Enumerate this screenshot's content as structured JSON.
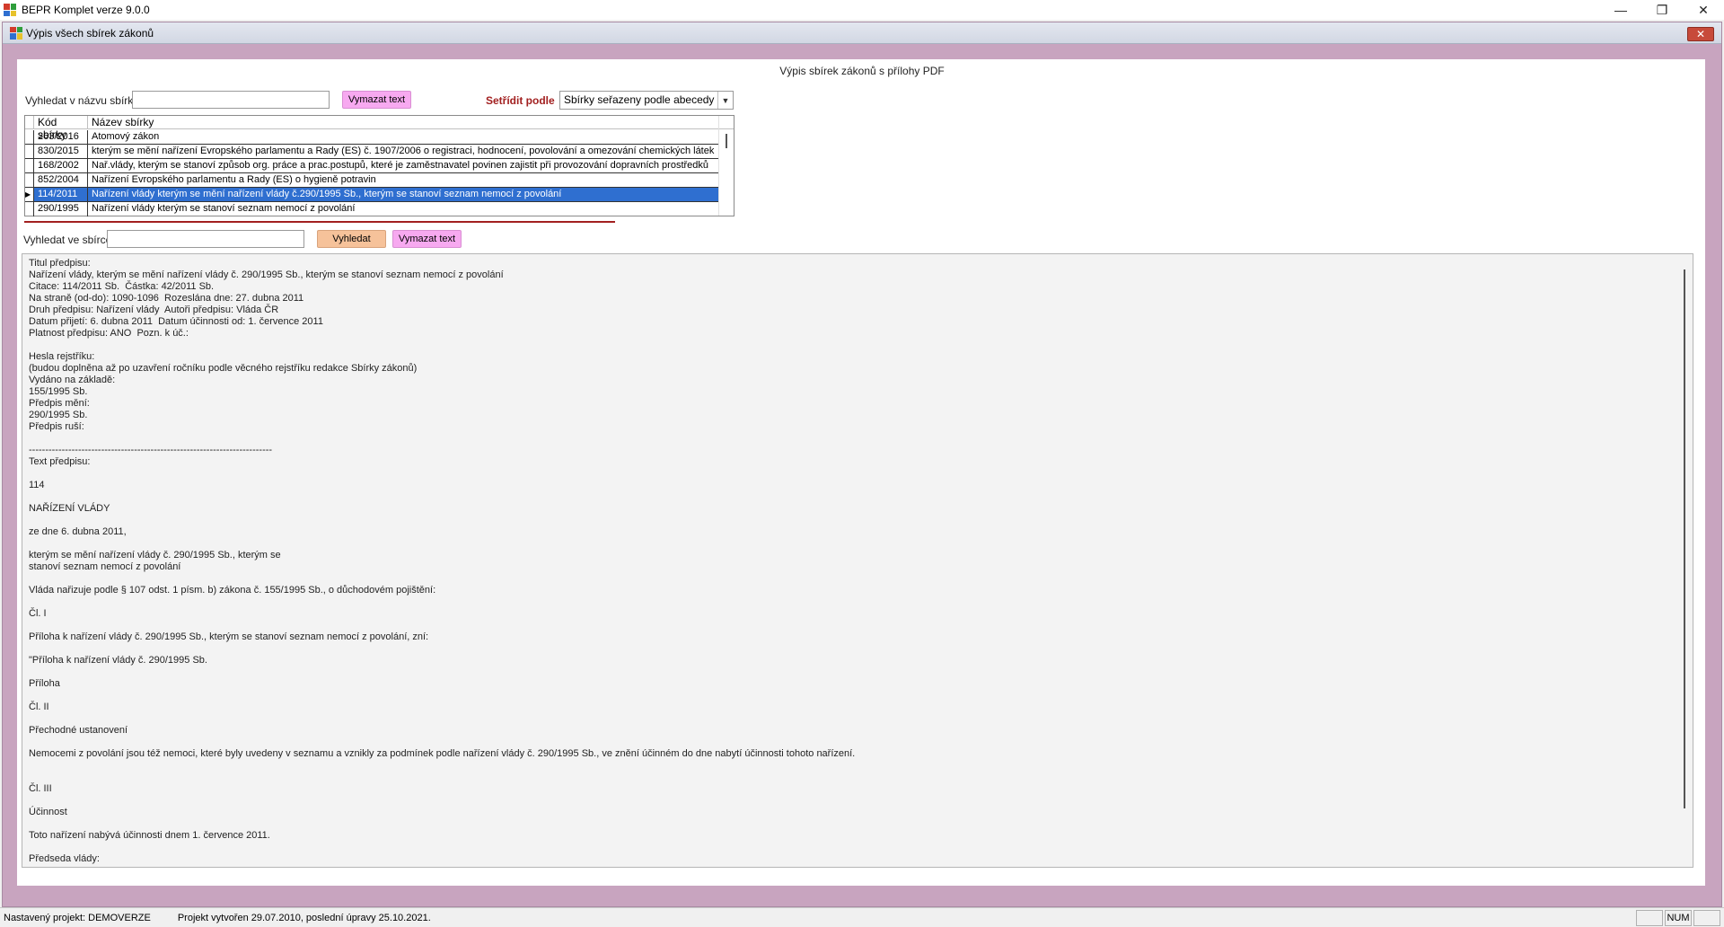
{
  "app": {
    "title": "BEPR Komplet verze 9.0.0"
  },
  "window_controls": {
    "minimize": "—",
    "maximize": "❐",
    "close": "✕"
  },
  "child_window": {
    "title": "Výpis všech sbírek zákonů",
    "close": "✕"
  },
  "panel": {
    "heading": "Výpis sbírek zákonů s přílohy PDF"
  },
  "search_name": {
    "label": "Vyhledat v názvu sbírky",
    "value": "",
    "clear_button": "Vymazat text"
  },
  "sort": {
    "label": "Setřídit podle",
    "selected": "Sbírky seřazeny podle abecedy"
  },
  "grid": {
    "headers": [
      "Kód sbírky",
      "Název sbírky"
    ],
    "rows": [
      {
        "code": "263/2016",
        "name": "Atomový zákon"
      },
      {
        "code": "830/2015",
        "name": "kterým se mění nařízení Evropského parlamentu a Rady (ES) č. 1907/2006 o registraci, hodnocení, povolování a omezování chemických látek"
      },
      {
        "code": "168/2002",
        "name": "Nař.vlády, kterým se stanoví způsob org. práce a prac.postupů, které je zaměstnavatel povinen zajistit při provozování dopravních prostředků"
      },
      {
        "code": "852/2004",
        "name": "Nařízení Evropského parlamentu a Rady (ES) o hygieně potravin"
      },
      {
        "code": "114/2011",
        "name": "Nařízení vlády kterým se mění nařízení vlády č.290/1995 Sb., kterým se stanoví seznam nemocí z povolání",
        "selected": true,
        "marker": "▶"
      },
      {
        "code": "290/1995",
        "name": "Nařízení vlády kterým se stanoví seznam nemocí z povolání"
      }
    ]
  },
  "search_in": {
    "label": "Vyhledat ve sbírce",
    "value": "",
    "search_button": "Vyhledat",
    "clear_button": "Vymazat text"
  },
  "document_text": "Titul předpisu:\nNařízení vlády, kterým se mění nařízení vlády č. 290/1995 Sb., kterým se stanoví seznam nemocí z povolání\nCitace: 114/2011 Sb.  Částka: 42/2011 Sb.\nNa straně (od-do): 1090-1096  Rozeslána dne: 27. dubna 2011\nDruh předpisu: Nařízení vlády  Autoři předpisu: Vláda ČR\nDatum přijetí: 6. dubna 2011  Datum účinnosti od: 1. července 2011\nPlatnost předpisu: ANO  Pozn. k úč.:\n\nHesla rejstříku:\n(budou doplněna až po uzavření ročníku podle věcného rejstříku redakce Sbírky zákonů)\nVydáno na základě:\n155/1995 Sb.\nPředpis mění:\n290/1995 Sb.\nPředpis ruší:\n\n--------------------------------------------------------------------------\nText předpisu:\n\n114\n\nNAŘÍZENÍ VLÁDY\n\nze dne 6. dubna 2011,\n\nkterým se mění nařízení vlády č. 290/1995 Sb., kterým se\nstanoví seznam nemocí z povolání\n\nVláda nařizuje podle § 107 odst. 1 písm. b) zákona č. 155/1995 Sb., o důchodovém pojištění:\n\nČl. I\n\nPříloha k nařízení vlády č. 290/1995 Sb., kterým se stanoví seznam nemocí z povolání, zní:\n\n\"Příloha k nařízení vlády č. 290/1995 Sb.\n\nPříloha\n\nČl. II\n\nPřechodné ustanovení\n\nNemocemi z povolání jsou též nemoci, které byly uvedeny v seznamu a vznikly za podmínek podle nařízení vlády č. 290/1995 Sb., ve znění účinném do dne nabytí účinnosti tohoto nařízení.\n\n\nČl. III\n\nÚčinnost\n\nToto nařízení nabývá účinnosti dnem 1. července 2011.\n\nPředseda vlády:",
  "status": {
    "project": "Nastavený projekt: DEMOVERZE",
    "created": "Projekt vytvořen 29.07.2010, poslední úpravy 25.10.2021.",
    "num": "NUM"
  },
  "colors": {
    "panel_frame": "#c8a4bf",
    "selection": "#2f6fd0",
    "accent_red": "#a22020",
    "pink_button": "#f7a9f0",
    "peach_button": "#f6c29a"
  }
}
